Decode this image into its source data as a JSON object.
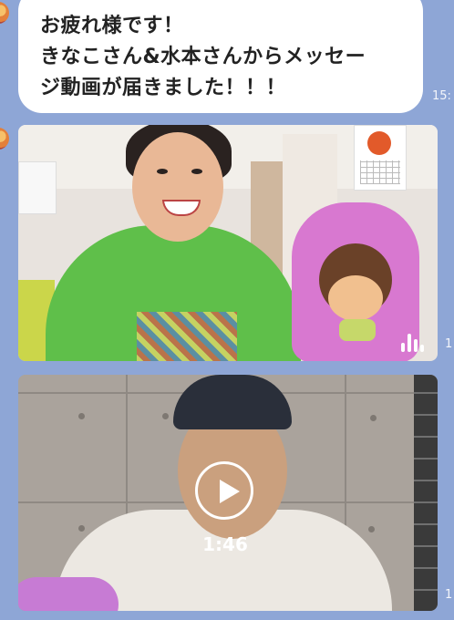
{
  "message": {
    "lines": [
      "お疲れ様です！",
      "きなこさん&水本さんからメッセー",
      "ジ動画が届きました！！！"
    ],
    "time": "15:"
  },
  "videos": [
    {
      "time": "1",
      "icon": "audio-bars-icon"
    },
    {
      "time": "1",
      "duration": "1:46",
      "icon": "play-icon"
    }
  ],
  "colors": {
    "chat_background": "#8ea6d6",
    "bubble": "#ffffff"
  }
}
